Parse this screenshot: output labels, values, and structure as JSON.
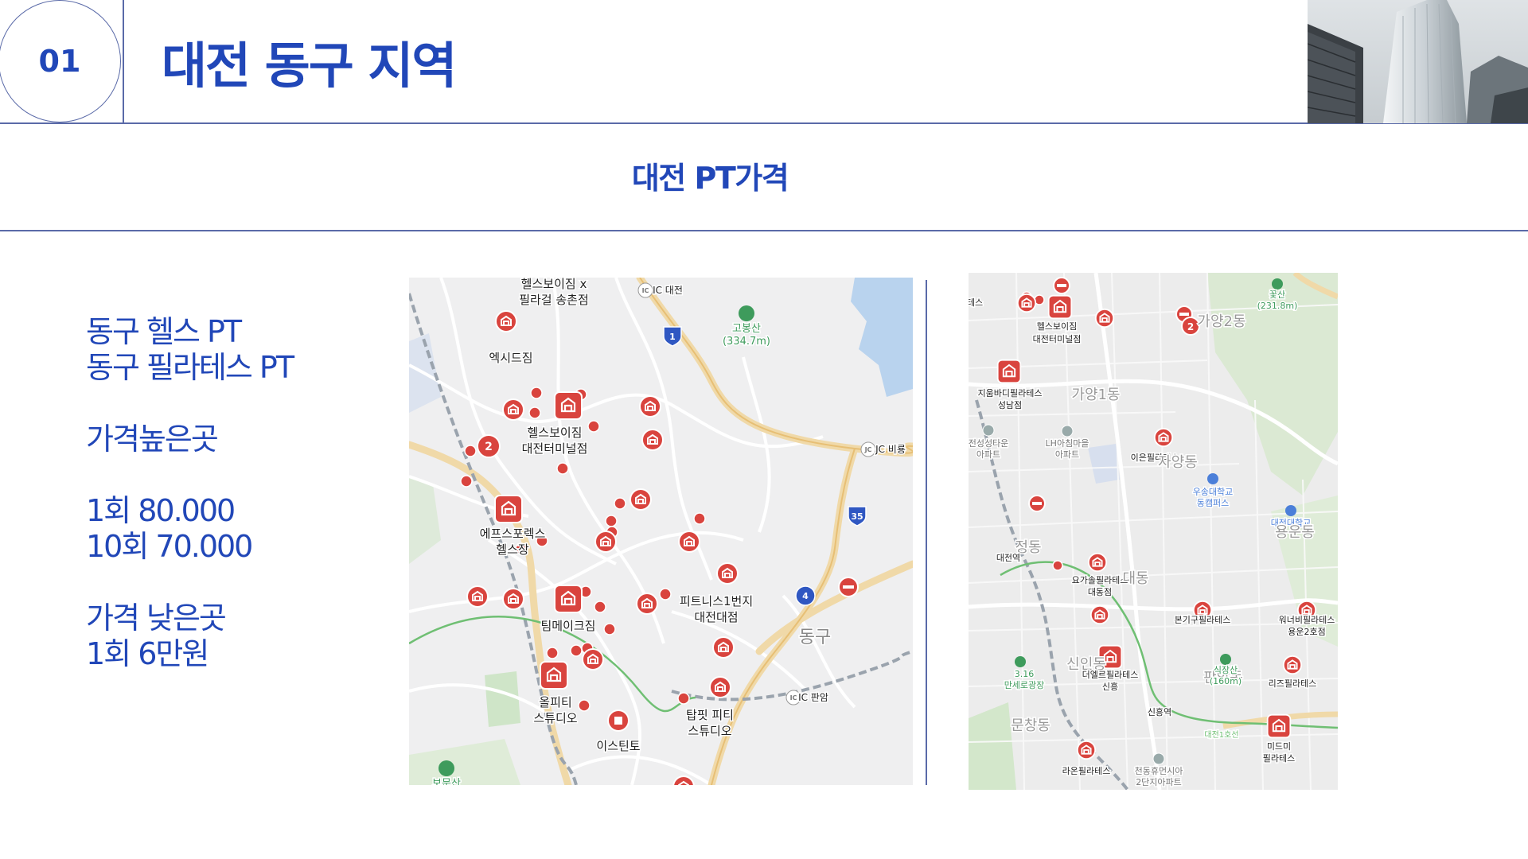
{
  "header": {
    "section_number": "01",
    "title": "대전 동구 지역"
  },
  "subtitle": "대전 PT가격",
  "info_lines": [
    "동구 헬스 PT",
    "동구 필라테스 PT",
    "",
    "가격높은곳",
    "",
    "1회 80.000",
    "10회 70.000",
    "",
    "가격 낮은곳",
    "1회 6만원"
  ],
  "colors": {
    "accent": "#2147b8",
    "line": "#5a6aa8",
    "marker": "#d9443e"
  },
  "map_left": {
    "labels": [
      "헬스보이짐 x",
      "필라걸 송촌점",
      "IC 대전",
      "고봉산",
      "(334.7m)",
      "엑시드짐",
      "헬스보이짐",
      "대전터미널점",
      "JC 비룡",
      "에프스포렉스",
      "헬스장",
      "피트니스1번지",
      "대전대점",
      "팀메이크짐",
      "동구",
      "IC 판암",
      "올피티",
      "스튜디오",
      "탑핏 피티",
      "스튜디오",
      "이스틴토",
      "보문산"
    ],
    "route_badges": [
      "1",
      "35",
      "4"
    ],
    "cluster_badges": [
      "2"
    ]
  },
  "map_right": {
    "labels": [
      "테스",
      "헬스보이짐",
      "대전터미널점",
      "가양2동",
      "꽃산",
      "(231.8m)",
      "지움바디필라테스",
      "성남점",
      "가양1동",
      "전성성타운",
      "아파트",
      "LH아침마을",
      "아파트",
      "이은필라테스",
      "자양동",
      "우송대학교",
      "동캠퍼스",
      "대전대학교",
      "용운동",
      "정동",
      "대전역",
      "요가솔필라테스",
      "대동점",
      "대동",
      "본기구필라테스",
      "워너비필라테스",
      "용운2호점",
      "3.16",
      "만세로광장",
      "신인동",
      "더엘르필라테스",
      "신흥",
      "판암동",
      "식장산",
      "(160m)",
      "리즈필라테스",
      "신흥역",
      "대전1호선",
      "문창동",
      "미드미",
      "필라테스",
      "라온필라테스",
      "천동휴먼시아",
      "2단지아파트"
    ],
    "cluster_badges": [
      "2"
    ]
  }
}
